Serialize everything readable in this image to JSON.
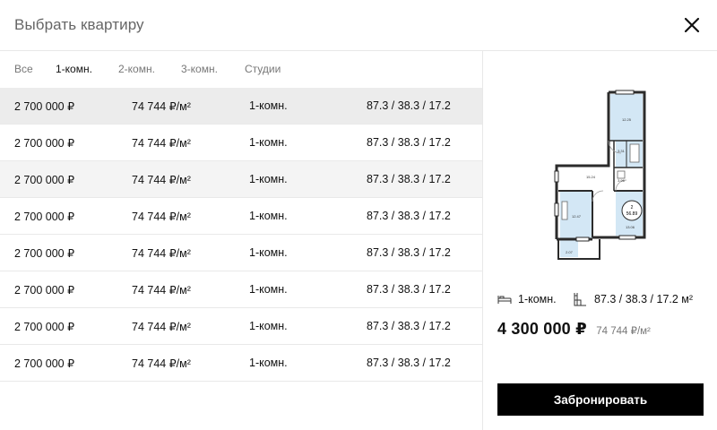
{
  "header": {
    "title": "Выбрать квартиру",
    "close_icon": "close-icon"
  },
  "tabs": [
    {
      "label": "Все",
      "active": false
    },
    {
      "label": "1-комн.",
      "active": true
    },
    {
      "label": "2-комн.",
      "active": false
    },
    {
      "label": "3-комн.",
      "active": false
    },
    {
      "label": "Студии",
      "active": false
    }
  ],
  "rows": [
    {
      "price": "2 700 000  ₽",
      "price_per_m2": "74 744 ₽/м²",
      "rooms": "1-комн.",
      "area": "87.3 / 38.3 / 17.2"
    },
    {
      "price": "2 700 000  ₽",
      "price_per_m2": "74 744 ₽/м²",
      "rooms": "1-комн.",
      "area": "87.3 / 38.3 / 17.2"
    },
    {
      "price": "2 700 000  ₽",
      "price_per_m2": "74 744 ₽/м²",
      "rooms": "1-комн.",
      "area": "87.3 / 38.3 / 17.2"
    },
    {
      "price": "2 700 000  ₽",
      "price_per_m2": "74 744 ₽/м²",
      "rooms": "1-комн.",
      "area": "87.3 / 38.3 / 17.2"
    },
    {
      "price": "2 700 000  ₽",
      "price_per_m2": "74 744 ₽/м²",
      "rooms": "1-комн.",
      "area": "87.3 / 38.3 / 17.2"
    },
    {
      "price": "2 700 000  ₽",
      "price_per_m2": "74 744 ₽/м²",
      "rooms": "1-комн.",
      "area": "87.3 / 38.3 / 17.2"
    },
    {
      "price": "2 700 000  ₽",
      "price_per_m2": "74 744 ₽/м²",
      "rooms": "1-комн.",
      "area": "87.3 / 38.3 / 17.2"
    },
    {
      "price": "2 700 000  ₽",
      "price_per_m2": "74 744 ₽/м²",
      "rooms": "1-комн.",
      "area": "87.3 / 38.3 / 17.2"
    }
  ],
  "detail": {
    "floorplan_icon": "floorplan-image",
    "floorplan_labels": {
      "room_top": "12.25",
      "bath1": "3.31",
      "bath2": "3.96",
      "hall": "15.24",
      "room_badge_num": "2",
      "room_badge_area": "56.89",
      "room_main": "13.06",
      "kitchen": "12.47",
      "balcony": "2.07"
    },
    "rooms_icon": "bed-icon",
    "rooms": "1-комн.",
    "area_icon": "area-plan-icon",
    "area": "87.3 / 38.3 / 17.2 м²",
    "price": "4 300 000  ₽",
    "price_per_m2": "74 744 ₽/м²",
    "book_button": "Забронировать"
  },
  "colors": {
    "accent": "#000000",
    "room_fill": "#d3e7f5",
    "wall": "#2b2b2b"
  }
}
